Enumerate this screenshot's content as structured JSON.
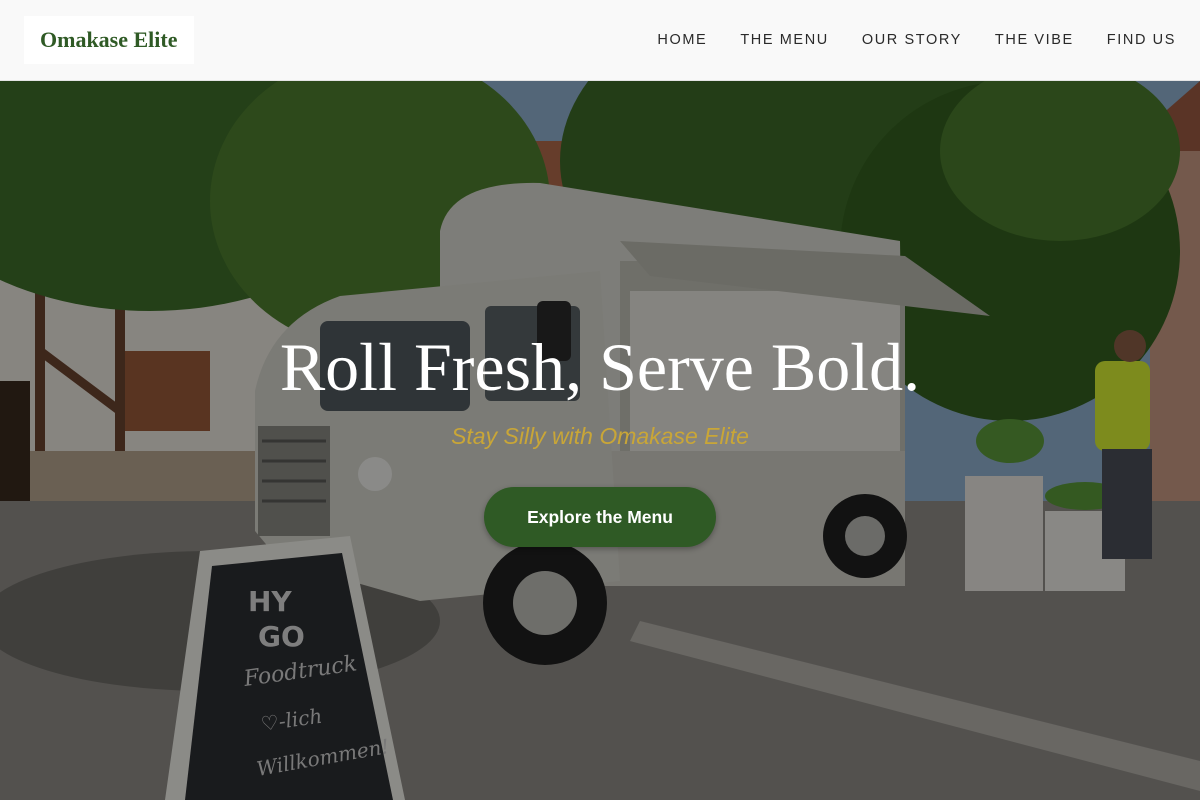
{
  "header": {
    "logo": "Omakase Elite",
    "nav": [
      {
        "label": "HOME"
      },
      {
        "label": "THE MENU"
      },
      {
        "label": "OUR STORY"
      },
      {
        "label": "THE VIBE"
      },
      {
        "label": "FIND US"
      }
    ]
  },
  "hero": {
    "title": "Roll Fresh, Serve Bold.",
    "subtitle": "Stay Silly with Omakase Elite",
    "cta_label": "Explore the Menu",
    "chalkboard_text": [
      "HY",
      "GO",
      "Foodtruck",
      "♡-lich",
      "Willkommen!"
    ]
  },
  "colors": {
    "brand_green": "#2f5a25",
    "accent_gold": "#c9a637",
    "header_bg": "#f9f9f9"
  }
}
